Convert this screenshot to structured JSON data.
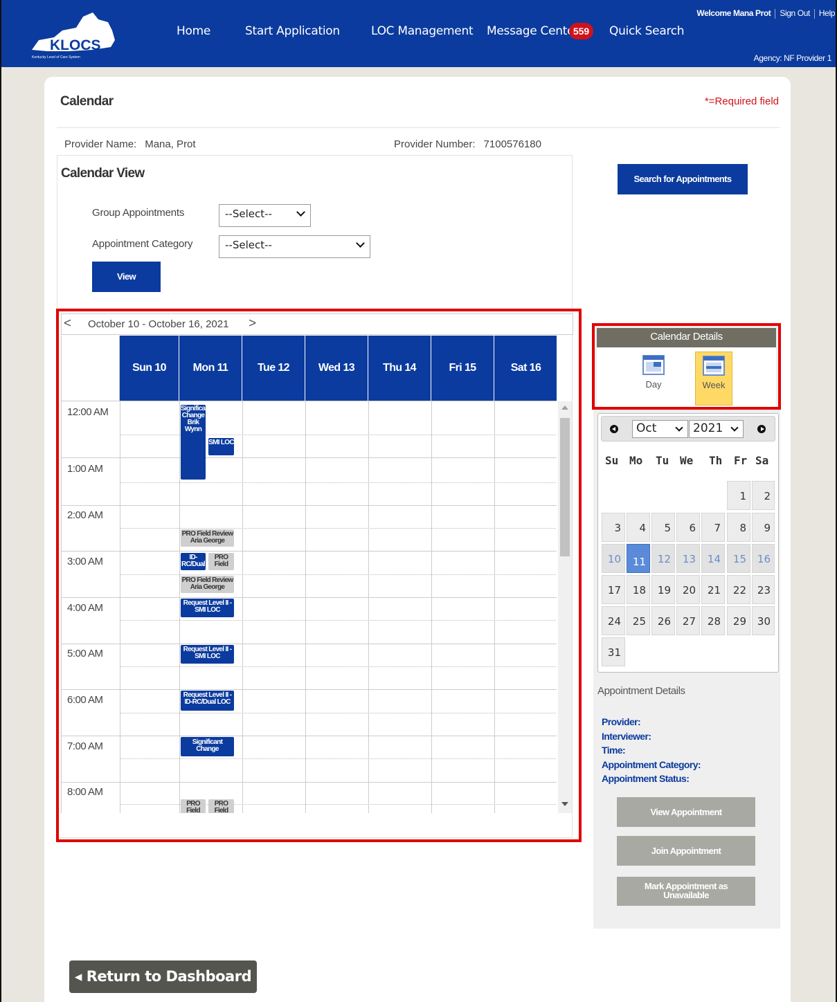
{
  "header": {
    "logo_text": "KLOCS",
    "logo_subtext": "Kentucky Level of Care System",
    "nav": [
      "Home",
      "Start Application",
      "LOC Management",
      "Message Center",
      "Quick Search"
    ],
    "message_count": "559",
    "welcome": "Welcome Mana Prot",
    "sign_out": "Sign Out",
    "help": "Help",
    "agency": "Agency: NF Provider 1"
  },
  "page": {
    "title": "Calendar",
    "required_note": "*=Required field",
    "provider_name_label": "Provider Name:",
    "provider_name": "Mana, Prot",
    "provider_number_label": "Provider Number:",
    "provider_number": "7100576180"
  },
  "calendar_view": {
    "title": "Calendar View",
    "group_label": "Group Appointments",
    "group_value": "--Select--",
    "category_label": "Appointment Category",
    "category_value": "--Select--",
    "view_button": "View",
    "search_button": "Search for Appointments"
  },
  "week": {
    "prev": "<",
    "next": ">",
    "range": "October 10 - October 16, 2021",
    "days": [
      "Sun 10",
      "Mon 11",
      "Tue 12",
      "Wed 13",
      "Thu 14",
      "Fri 15",
      "Sat 16"
    ],
    "times": [
      "12:00 AM",
      "1:00 AM",
      "2:00 AM",
      "3:00 AM",
      "4:00 AM",
      "5:00 AM",
      "6:00 AM",
      "7:00 AM",
      "8:00 AM"
    ],
    "appointments": [
      {
        "text": "Significant Change Brik Wynn",
        "style": "blue"
      },
      {
        "text": "SMI LOC",
        "style": "blue"
      },
      {
        "text": "PRO Field Review Aria George",
        "style": "gray"
      },
      {
        "text": "ID-RC/Dual",
        "style": "blue"
      },
      {
        "text": "PRO Field",
        "style": "gray"
      },
      {
        "text": "PRO Field Review Aria George",
        "style": "gray"
      },
      {
        "text": "Request Level II - SMI LOC",
        "style": "blue"
      },
      {
        "text": "Request Level II - SMI LOC",
        "style": "blue"
      },
      {
        "text": "Request Level II - ID-RC/Dual LOC",
        "style": "blue"
      },
      {
        "text": "Significant Change",
        "style": "blue"
      },
      {
        "text": "PRO Field",
        "style": "gray"
      },
      {
        "text": "PRO Field",
        "style": "gray"
      }
    ]
  },
  "calendar_details": {
    "title": "Calendar Details",
    "day": "Day",
    "week": "Week",
    "active": "Week"
  },
  "mini_calendar": {
    "month": "Oct",
    "year": "2021",
    "dow": [
      "Su",
      "Mo",
      "Tu",
      "We",
      "Th",
      "Fr",
      "Sa"
    ],
    "weeks": [
      [
        "",
        "",
        "",
        "",
        "",
        "1",
        "2"
      ],
      [
        "3",
        "4",
        "5",
        "6",
        "7",
        "8",
        "9"
      ],
      [
        "10",
        "11",
        "12",
        "13",
        "14",
        "15",
        "16"
      ],
      [
        "17",
        "18",
        "19",
        "20",
        "21",
        "22",
        "23"
      ],
      [
        "24",
        "25",
        "26",
        "27",
        "28",
        "29",
        "30"
      ],
      [
        "31",
        "",
        "",
        "",
        "",
        "",
        ""
      ]
    ],
    "selected": "11"
  },
  "appointment_details": {
    "title": "Appointment Details",
    "fields": [
      "Provider:",
      "Interviewer:",
      "Time:",
      "Appointment Category:",
      "Appointment Status:"
    ],
    "buttons": [
      "View Appointment",
      "Join Appointment",
      "Mark Appointment as Unavailable"
    ]
  },
  "footer": {
    "return": "◂ Return to Dashboard"
  },
  "colors": {
    "brand_blue": "#0b3b9e",
    "highlight_red": "#e00000",
    "badge_red": "#d0121b",
    "selected_day": "#5b8bd8",
    "active_view": "#ffd966"
  }
}
